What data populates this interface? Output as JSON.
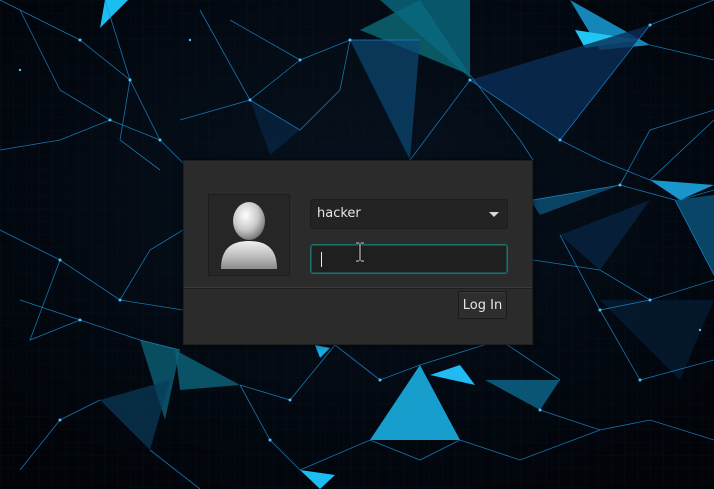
{
  "login": {
    "username": "hacker",
    "password_value": "",
    "login_button_label": "Log In"
  },
  "icons": {
    "avatar": "default-user-avatar-icon",
    "dropdown": "chevron-down-icon",
    "cursor": "text-ibeam-cursor-icon"
  },
  "colors": {
    "background": "#02060c",
    "accent": "#00b4ff",
    "panel": "#2b2b2b",
    "focus_border": "#1f6f6a"
  }
}
